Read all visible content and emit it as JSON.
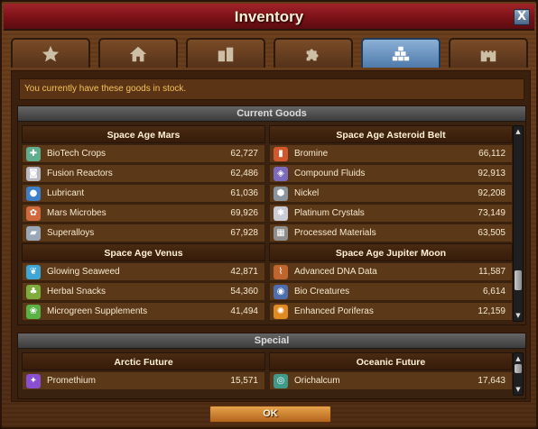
{
  "window": {
    "title": "Inventory",
    "close_label": "X"
  },
  "tabs": [
    {
      "icon": "star-icon",
      "active": false
    },
    {
      "icon": "house-icon",
      "active": false
    },
    {
      "icon": "buildings-icon",
      "active": false
    },
    {
      "icon": "puzzle-icon",
      "active": false
    },
    {
      "icon": "goods-stack-icon",
      "active": true
    },
    {
      "icon": "castle-icon",
      "active": false
    }
  ],
  "notice": "You currently have these goods in stock.",
  "current_goods": {
    "heading": "Current Goods",
    "left": [
      {
        "era": "Space Age Mars",
        "items": [
          {
            "name": "BioTech Crops",
            "amount": "62,727",
            "icon": "biotech-crops-icon",
            "color": "#5fae8d"
          },
          {
            "name": "Fusion Reactors",
            "amount": "62,486",
            "icon": "fusion-reactor-icon",
            "color": "#b9b9c4"
          },
          {
            "name": "Lubricant",
            "amount": "61,036",
            "icon": "lubricant-icon",
            "color": "#3e7fc9"
          },
          {
            "name": "Mars Microbes",
            "amount": "69,926",
            "icon": "mars-microbes-icon",
            "color": "#d0693b"
          },
          {
            "name": "Superalloys",
            "amount": "67,928",
            "icon": "superalloys-icon",
            "color": "#9aa7b8"
          }
        ]
      },
      {
        "era": "Space Age Venus",
        "items": [
          {
            "name": "Glowing Seaweed",
            "amount": "42,871",
            "icon": "seaweed-icon",
            "color": "#3fa6d8"
          },
          {
            "name": "Herbal Snacks",
            "amount": "54,360",
            "icon": "herbal-snacks-icon",
            "color": "#7dac3a"
          },
          {
            "name": "Microgreen Supplements",
            "amount": "41,494",
            "icon": "microgreen-icon",
            "color": "#5bb244"
          }
        ]
      }
    ],
    "right": [
      {
        "era": "Space Age Asteroid Belt",
        "items": [
          {
            "name": "Bromine",
            "amount": "66,112",
            "icon": "bromine-icon",
            "color": "#d2572c"
          },
          {
            "name": "Compound Fluids",
            "amount": "92,913",
            "icon": "compound-fluids-icon",
            "color": "#7c6bbd"
          },
          {
            "name": "Nickel",
            "amount": "92,208",
            "icon": "nickel-icon",
            "color": "#8b959f"
          },
          {
            "name": "Platinum Crystals",
            "amount": "73,149",
            "icon": "platinum-crystals-icon",
            "color": "#c9ccd4"
          },
          {
            "name": "Processed Materials",
            "amount": "63,505",
            "icon": "processed-materials-icon",
            "color": "#8f8f8f"
          }
        ]
      },
      {
        "era": "Space Age Jupiter Moon",
        "items": [
          {
            "name": "Advanced DNA Data",
            "amount": "11,587",
            "icon": "dna-data-icon",
            "color": "#c0652e"
          },
          {
            "name": "Bio Creatures",
            "amount": "6,614",
            "icon": "bio-creatures-icon",
            "color": "#4d6fb0"
          },
          {
            "name": "Enhanced Poriferas",
            "amount": "12,159",
            "icon": "poriferas-icon",
            "color": "#e08a22"
          }
        ]
      }
    ]
  },
  "special": {
    "heading": "Special",
    "left": {
      "era": "Arctic Future",
      "items": [
        {
          "name": "Promethium",
          "amount": "15,571",
          "icon": "promethium-icon",
          "color": "#8a4fd1"
        }
      ]
    },
    "right": {
      "era": "Oceanic Future",
      "items": [
        {
          "name": "Orichalcum",
          "amount": "17,643",
          "icon": "orichalcum-icon",
          "color": "#3f9a8a"
        }
      ]
    }
  },
  "ok_label": "OK"
}
